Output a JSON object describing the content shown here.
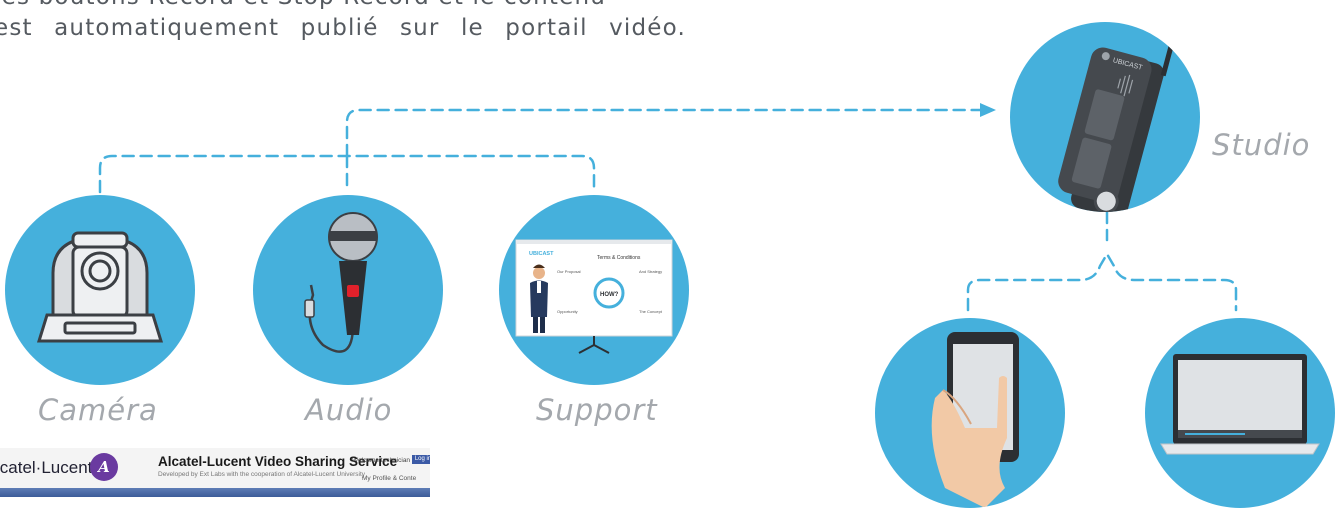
{
  "intro": {
    "line1": "les boutons Record et Stop Record et le contenu",
    "line2": "est automatiquement publié sur le portail vidéo."
  },
  "sources": [
    {
      "label": "Caméra"
    },
    {
      "label": "Audio"
    },
    {
      "label": "Support"
    }
  ],
  "studio": {
    "label": "Studio",
    "brand": "UBICAST"
  },
  "slide": {
    "brand": "UBICAST",
    "heading": "Terms & Conditions",
    "center": "HOW?",
    "items": [
      "Our Proposal",
      "And Strategy",
      "Opportunity",
      "The Concept"
    ]
  },
  "portal": {
    "brand": "lcatel·Lucent",
    "logo_mark": "A",
    "title": "Alcatel-Lucent Video Sharing Service",
    "subtitle": "Developed by Ext Labs with the cooperation of Alcatel-Lucent University",
    "welcome": "Welcome technician",
    "login": "Log in",
    "profile": "My Profile & Conte"
  },
  "colors": {
    "circle": "#45b0dc",
    "connector": "#45b0dc",
    "label": "#a4a8ad",
    "text": "#555a60"
  }
}
